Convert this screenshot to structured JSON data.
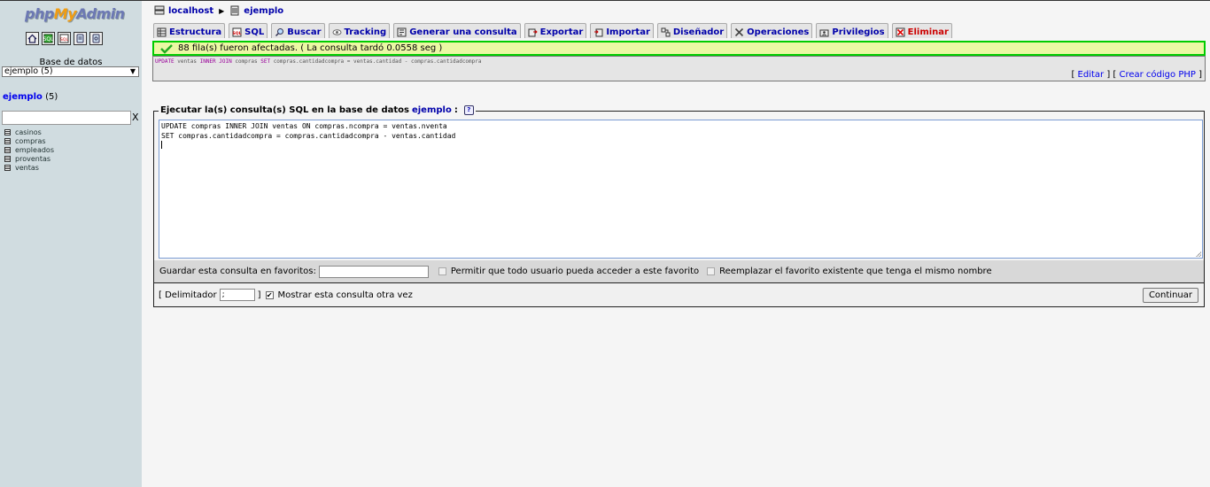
{
  "logo": {
    "php": "php",
    "my": "My",
    "admin": "Admin"
  },
  "sidebar": {
    "icons": [
      "home-icon",
      "sql-query-icon",
      "sql-window-icon",
      "docs-icon",
      "help-icon"
    ],
    "db_label": "Base de datos",
    "db_select_value": "ejemplo (5)",
    "current_db": "ejemplo",
    "current_db_count": "(5)",
    "filter_placeholder": "",
    "filter_clear": "X",
    "tables": [
      "casinos",
      "compras",
      "empleados",
      "proventas",
      "ventas"
    ]
  },
  "breadcrumb": {
    "server": "localhost",
    "database": "ejemplo"
  },
  "tabs": [
    {
      "label": "Estructura",
      "icon": "structure-icon"
    },
    {
      "label": "SQL",
      "icon": "sql-icon"
    },
    {
      "label": "Buscar",
      "icon": "search-icon"
    },
    {
      "label": "Tracking",
      "icon": "eye-icon"
    },
    {
      "label": "Generar una consulta",
      "icon": "query-icon"
    },
    {
      "label": "Exportar",
      "icon": "export-icon"
    },
    {
      "label": "Importar",
      "icon": "import-icon"
    },
    {
      "label": "Diseñador",
      "icon": "designer-icon"
    },
    {
      "label": "Operaciones",
      "icon": "tools-icon"
    },
    {
      "label": "Privilegios",
      "icon": "privileges-icon"
    },
    {
      "label": "Eliminar",
      "icon": "delete-icon"
    }
  ],
  "result": {
    "message": "88 fila(s) fueron afectadas. ( La consulta tardó 0.0558 seg )",
    "sql_kw1": "UPDATE",
    "sql_t1": " ventas ",
    "sql_kw2": "INNER JOIN",
    "sql_t2": " compras ",
    "sql_kw3": "SET",
    "sql_t3": " compras.cantidadcompra = ventas.cantidad - compras.cantidadcompra",
    "edit_link": "Editar",
    "php_link": "Crear código PHP"
  },
  "query": {
    "legend_prefix": "Ejecutar la(s) consulta(s) SQL en la base de datos",
    "legend_db": "ejemplo",
    "legend_suffix": ":",
    "help": "?",
    "line1": "UPDATE compras INNER JOIN ventas ON compras.ncompra = ventas.nventa",
    "line2": "SET compras.cantidadcompra = compras.cantidadcompra - ventas.cantidad"
  },
  "bookmark": {
    "label": "Guardar esta consulta en favoritos:",
    "opt_public": "Permitir que todo usuario pueda acceder a este favorito",
    "opt_replace": "Reemplazar el favorito existente que tenga el mismo nombre"
  },
  "footer": {
    "delimiter_label": "[ Delimitador",
    "delimiter_value": ";",
    "delimiter_close": "]",
    "show_again": "Mostrar esta consulta otra vez",
    "continue_label": "Continuar"
  }
}
